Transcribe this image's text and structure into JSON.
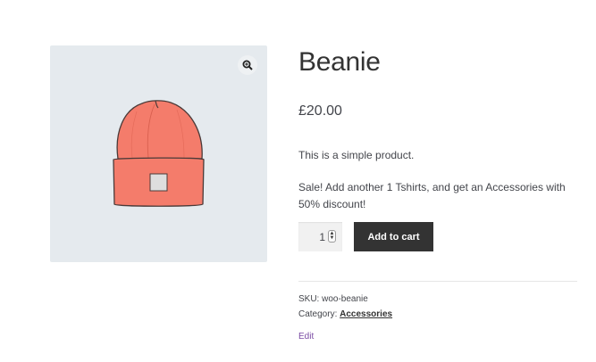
{
  "product": {
    "title": "Beanie",
    "price": "£20.00",
    "short_description": "This is a simple product.",
    "sale_note": "Sale! Add another 1 Tshirts, and get an Accessories with 50% discount!"
  },
  "gallery": {
    "zoom_icon": "zoom-in-icon",
    "image_name": "beanie-hat-image",
    "colors": {
      "background": "#e5eaee",
      "hat": "#f47c6b"
    }
  },
  "cart": {
    "quantity": "1",
    "add_to_cart_label": "Add to cart"
  },
  "meta": {
    "sku_label": "SKU:",
    "sku_value": "woo-beanie",
    "category_label": "Category:",
    "category_value": "Accessories"
  },
  "admin": {
    "edit_label": "Edit"
  }
}
